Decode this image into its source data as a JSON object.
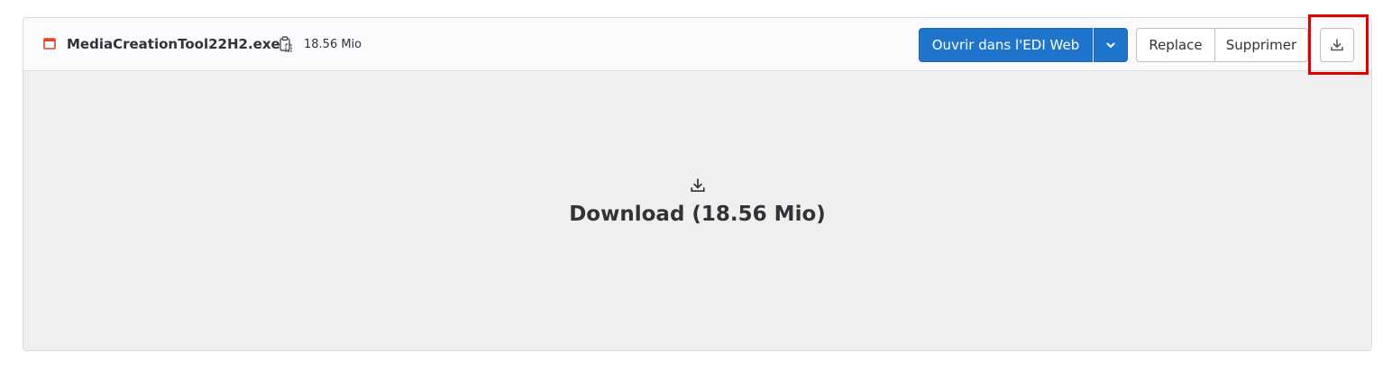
{
  "file": {
    "name": "MediaCreationTool22H2.exe",
    "size": "18.56 Mio",
    "icon": "application-window-icon",
    "icon_color": "#e24329"
  },
  "actions": {
    "open_web_ide": "Ouvrir dans l'EDI Web",
    "dropdown_icon": "chevron-down-icon",
    "replace": "Replace",
    "delete": "Supprimer",
    "download_icon": "download-icon"
  },
  "content": {
    "download_label": "Download (18.56 Mio)",
    "download_icon": "download-icon"
  },
  "colors": {
    "primary": "#1f75cb",
    "header_bg": "#fbfafd",
    "content_bg": "#efefef",
    "highlight": "#e00000"
  }
}
